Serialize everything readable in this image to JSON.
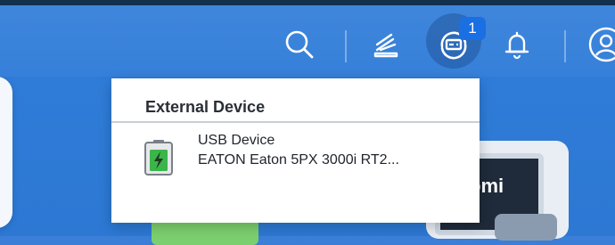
{
  "header": {
    "notification_count": "1",
    "icons": [
      "search-icon",
      "task-icon",
      "external-device-icon",
      "bell-icon",
      "user-icon"
    ]
  },
  "popup": {
    "title": "External Device",
    "devices": [
      {
        "type": "USB Device",
        "name": "EATON Eaton 5PX 3000i RT2...",
        "icon": "battery-icon"
      }
    ]
  },
  "desktop": {
    "monitor_label": "omi"
  },
  "colors": {
    "accent": "#1a6fe3",
    "topbar": "#3680da",
    "battery_green": "#3bb54a"
  }
}
